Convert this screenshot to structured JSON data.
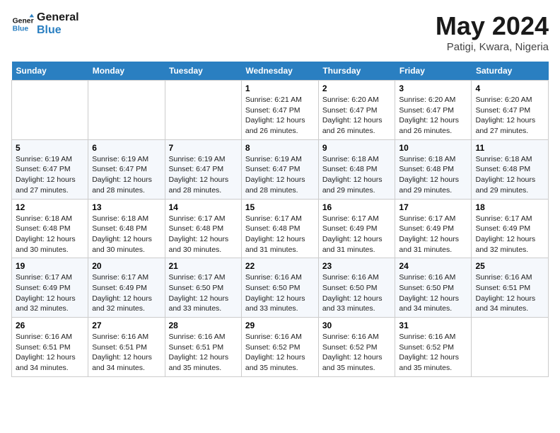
{
  "header": {
    "logo_line1": "General",
    "logo_line2": "Blue",
    "title": "May 2024",
    "subtitle": "Patigi, Kwara, Nigeria"
  },
  "calendar": {
    "weekdays": [
      "Sunday",
      "Monday",
      "Tuesday",
      "Wednesday",
      "Thursday",
      "Friday",
      "Saturday"
    ],
    "weeks": [
      [
        {
          "day": "",
          "info": ""
        },
        {
          "day": "",
          "info": ""
        },
        {
          "day": "",
          "info": ""
        },
        {
          "day": "1",
          "info": "Sunrise: 6:21 AM\nSunset: 6:47 PM\nDaylight: 12 hours\nand 26 minutes."
        },
        {
          "day": "2",
          "info": "Sunrise: 6:20 AM\nSunset: 6:47 PM\nDaylight: 12 hours\nand 26 minutes."
        },
        {
          "day": "3",
          "info": "Sunrise: 6:20 AM\nSunset: 6:47 PM\nDaylight: 12 hours\nand 26 minutes."
        },
        {
          "day": "4",
          "info": "Sunrise: 6:20 AM\nSunset: 6:47 PM\nDaylight: 12 hours\nand 27 minutes."
        }
      ],
      [
        {
          "day": "5",
          "info": "Sunrise: 6:19 AM\nSunset: 6:47 PM\nDaylight: 12 hours\nand 27 minutes."
        },
        {
          "day": "6",
          "info": "Sunrise: 6:19 AM\nSunset: 6:47 PM\nDaylight: 12 hours\nand 28 minutes."
        },
        {
          "day": "7",
          "info": "Sunrise: 6:19 AM\nSunset: 6:47 PM\nDaylight: 12 hours\nand 28 minutes."
        },
        {
          "day": "8",
          "info": "Sunrise: 6:19 AM\nSunset: 6:47 PM\nDaylight: 12 hours\nand 28 minutes."
        },
        {
          "day": "9",
          "info": "Sunrise: 6:18 AM\nSunset: 6:48 PM\nDaylight: 12 hours\nand 29 minutes."
        },
        {
          "day": "10",
          "info": "Sunrise: 6:18 AM\nSunset: 6:48 PM\nDaylight: 12 hours\nand 29 minutes."
        },
        {
          "day": "11",
          "info": "Sunrise: 6:18 AM\nSunset: 6:48 PM\nDaylight: 12 hours\nand 29 minutes."
        }
      ],
      [
        {
          "day": "12",
          "info": "Sunrise: 6:18 AM\nSunset: 6:48 PM\nDaylight: 12 hours\nand 30 minutes."
        },
        {
          "day": "13",
          "info": "Sunrise: 6:18 AM\nSunset: 6:48 PM\nDaylight: 12 hours\nand 30 minutes."
        },
        {
          "day": "14",
          "info": "Sunrise: 6:17 AM\nSunset: 6:48 PM\nDaylight: 12 hours\nand 30 minutes."
        },
        {
          "day": "15",
          "info": "Sunrise: 6:17 AM\nSunset: 6:48 PM\nDaylight: 12 hours\nand 31 minutes."
        },
        {
          "day": "16",
          "info": "Sunrise: 6:17 AM\nSunset: 6:49 PM\nDaylight: 12 hours\nand 31 minutes."
        },
        {
          "day": "17",
          "info": "Sunrise: 6:17 AM\nSunset: 6:49 PM\nDaylight: 12 hours\nand 31 minutes."
        },
        {
          "day": "18",
          "info": "Sunrise: 6:17 AM\nSunset: 6:49 PM\nDaylight: 12 hours\nand 32 minutes."
        }
      ],
      [
        {
          "day": "19",
          "info": "Sunrise: 6:17 AM\nSunset: 6:49 PM\nDaylight: 12 hours\nand 32 minutes."
        },
        {
          "day": "20",
          "info": "Sunrise: 6:17 AM\nSunset: 6:49 PM\nDaylight: 12 hours\nand 32 minutes."
        },
        {
          "day": "21",
          "info": "Sunrise: 6:17 AM\nSunset: 6:50 PM\nDaylight: 12 hours\nand 33 minutes."
        },
        {
          "day": "22",
          "info": "Sunrise: 6:16 AM\nSunset: 6:50 PM\nDaylight: 12 hours\nand 33 minutes."
        },
        {
          "day": "23",
          "info": "Sunrise: 6:16 AM\nSunset: 6:50 PM\nDaylight: 12 hours\nand 33 minutes."
        },
        {
          "day": "24",
          "info": "Sunrise: 6:16 AM\nSunset: 6:50 PM\nDaylight: 12 hours\nand 34 minutes."
        },
        {
          "day": "25",
          "info": "Sunrise: 6:16 AM\nSunset: 6:51 PM\nDaylight: 12 hours\nand 34 minutes."
        }
      ],
      [
        {
          "day": "26",
          "info": "Sunrise: 6:16 AM\nSunset: 6:51 PM\nDaylight: 12 hours\nand 34 minutes."
        },
        {
          "day": "27",
          "info": "Sunrise: 6:16 AM\nSunset: 6:51 PM\nDaylight: 12 hours\nand 34 minutes."
        },
        {
          "day": "28",
          "info": "Sunrise: 6:16 AM\nSunset: 6:51 PM\nDaylight: 12 hours\nand 35 minutes."
        },
        {
          "day": "29",
          "info": "Sunrise: 6:16 AM\nSunset: 6:52 PM\nDaylight: 12 hours\nand 35 minutes."
        },
        {
          "day": "30",
          "info": "Sunrise: 6:16 AM\nSunset: 6:52 PM\nDaylight: 12 hours\nand 35 minutes."
        },
        {
          "day": "31",
          "info": "Sunrise: 6:16 AM\nSunset: 6:52 PM\nDaylight: 12 hours\nand 35 minutes."
        },
        {
          "day": "",
          "info": ""
        }
      ]
    ]
  }
}
